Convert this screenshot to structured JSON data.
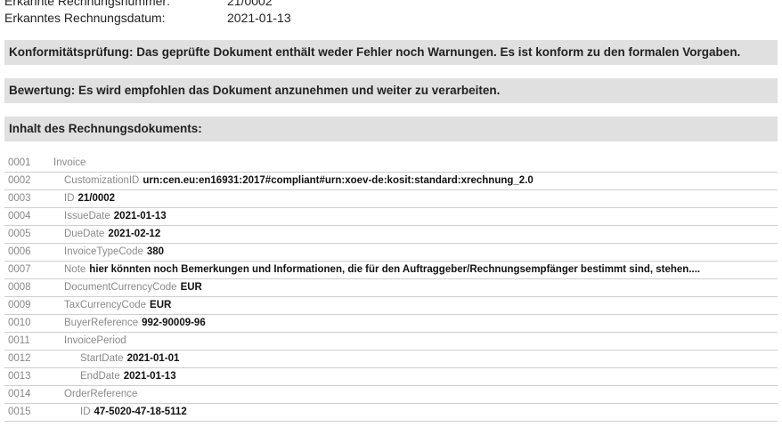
{
  "meta": {
    "rows": [
      {
        "label": "Erkannte Rechnungsnummer:",
        "value": "21/0002"
      },
      {
        "label": "Erkanntes Rechnungsdatum:",
        "value": "2021-01-13"
      }
    ]
  },
  "banners": {
    "conformity": "Konformitätsprüfung: Das geprüfte Dokument enthält weder Fehler noch Warnungen. Es ist konform zu den formalen Vorgaben.",
    "rating": "Bewertung: Es wird empfohlen das Dokument anzunehmen und weiter zu verarbeiten.",
    "content": "Inhalt des Rechnungsdokuments:"
  },
  "document": {
    "rows": [
      {
        "no": "0001",
        "tag": "Invoice",
        "value": ""
      },
      {
        "no": "0002",
        "tag": "CustomizationID",
        "value": "urn:cen.eu:en16931:2017#compliant#urn:xoev-de:kosit:standard:xrechnung_2.0"
      },
      {
        "no": "0003",
        "tag": "ID",
        "value": "21/0002"
      },
      {
        "no": "0004",
        "tag": "IssueDate",
        "value": "2021-01-13"
      },
      {
        "no": "0005",
        "tag": "DueDate",
        "value": "2021-02-12"
      },
      {
        "no": "0006",
        "tag": "InvoiceTypeCode",
        "value": "380"
      },
      {
        "no": "0007",
        "tag": "Note",
        "value": "hier könnten noch Bemerkungen und Informationen, die für den Auftraggeber/Rechnungsempfänger bestimmt sind, stehen...."
      },
      {
        "no": "0008",
        "tag": "DocumentCurrencyCode",
        "value": "EUR"
      },
      {
        "no": "0009",
        "tag": "TaxCurrencyCode",
        "value": "EUR"
      },
      {
        "no": "0010",
        "tag": "BuyerReference",
        "value": "992-90009-96"
      },
      {
        "no": "0011",
        "tag": "InvoicePeriod",
        "value": ""
      },
      {
        "no": "0012",
        "tag": "StartDate",
        "value": "2021-01-01"
      },
      {
        "no": "0013",
        "tag": "EndDate",
        "value": "2021-01-13"
      },
      {
        "no": "0014",
        "tag": "OrderReference",
        "value": ""
      },
      {
        "no": "0015",
        "tag": "ID",
        "value": "47-5020-47-18-5112"
      }
    ]
  }
}
